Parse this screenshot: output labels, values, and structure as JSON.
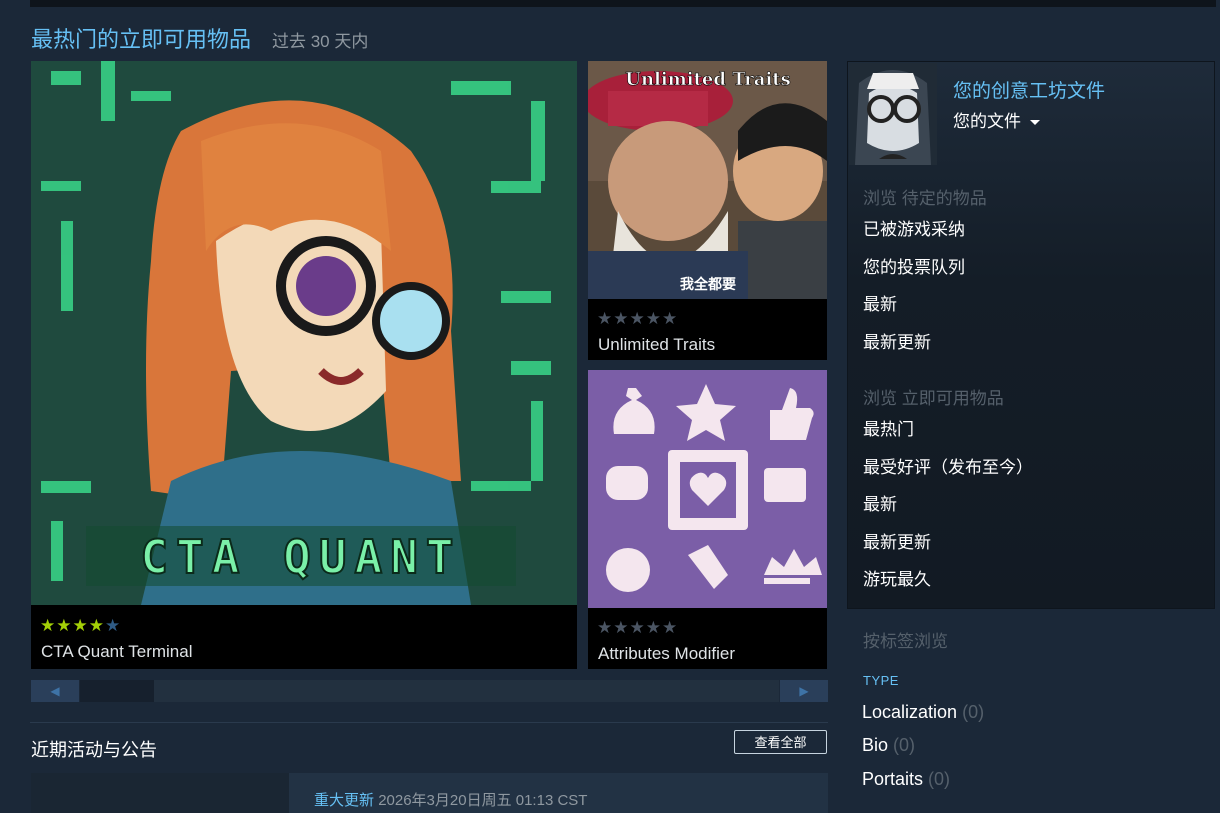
{
  "header": {
    "title": "最热门的立即可用物品",
    "subtitle": "过去 30 天内"
  },
  "items": [
    {
      "name": "CTA Quant Terminal",
      "rating": 4,
      "stars": "★★★★★",
      "art_text": "CTA QUANT"
    },
    {
      "name": "Unlimited Traits",
      "rating": 0,
      "stars": "★★★★★",
      "art_banner": "Unlimited Traits",
      "art_caption": "我全都要"
    },
    {
      "name": "Attributes Modifier",
      "rating": 0,
      "stars": "★★★★★"
    }
  ],
  "colors": {
    "accent": "#66c0f4",
    "star_on": "#a4d007",
    "star_off": "#4b5563",
    "purple": "#7b5ea7"
  },
  "pager": {
    "prev_icon": "◀",
    "next_icon": "▶"
  },
  "news": {
    "title": "近期活动与公告",
    "view_all": "查看全部",
    "tag": "重大更新",
    "date": "2026年3月20日周五 01:13 CST"
  },
  "panel": {
    "workshop_title": "您的创意工坊文件",
    "your_files": "您的文件",
    "dropdown_icon": "caret-down-icon",
    "browse_pending": "浏览 待定的物品",
    "pending_links": [
      "已被游戏采纳",
      "您的投票队列",
      "最新",
      "最新更新"
    ],
    "browse_ready": "浏览 立即可用物品",
    "ready_links": [
      "最热门",
      "最受好评（发布至今）",
      "最新",
      "最新更新",
      "游玩最久"
    ]
  },
  "tags": {
    "heading": "按标签浏览",
    "type_label": "TYPE",
    "items": [
      {
        "label": "Localization",
        "count": "(0)"
      },
      {
        "label": "Bio",
        "count": "(0)"
      },
      {
        "label": "Portaits",
        "count": "(0)"
      }
    ]
  }
}
